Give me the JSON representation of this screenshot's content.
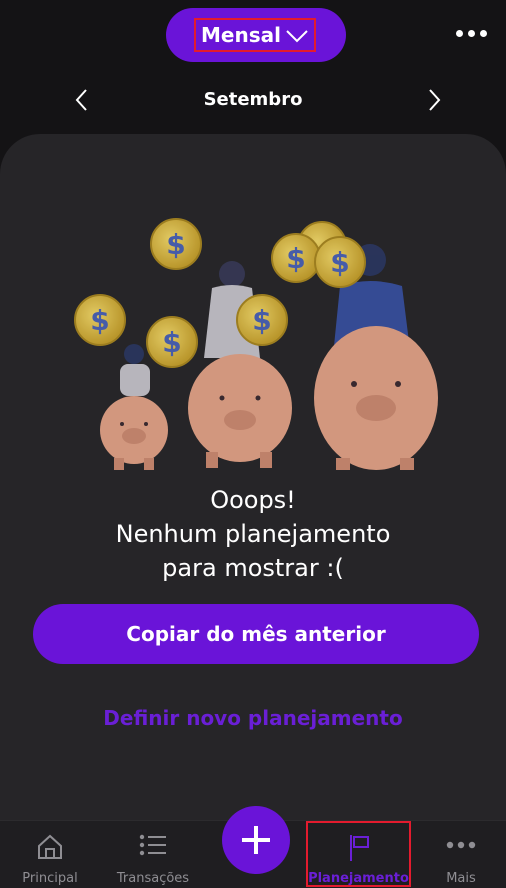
{
  "header": {
    "period_selector": "Mensal",
    "month": "Setembro"
  },
  "empty_state": {
    "line1": "Ooops!",
    "line2": "Nenhum planejamento",
    "line3": "para mostrar :("
  },
  "actions": {
    "copy_previous": "Copiar do mês anterior",
    "define_new": "Definir novo planejamento"
  },
  "bottom_nav": {
    "items": [
      {
        "label": "Principal",
        "icon": "home-icon"
      },
      {
        "label": "Transações",
        "icon": "list-icon"
      },
      {
        "label": "Planejamento",
        "icon": "flag-icon",
        "active": true
      },
      {
        "label": "Mais",
        "icon": "more-icon"
      }
    ],
    "fab_icon": "plus-icon"
  },
  "colors": {
    "accent": "#6a14d8",
    "background": "#141315",
    "card": "#262528",
    "highlight": "#e31b2e"
  }
}
